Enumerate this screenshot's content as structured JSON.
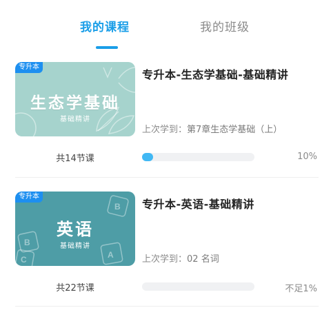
{
  "tabs": [
    {
      "label": "我的课程",
      "active": true
    },
    {
      "label": "我的班级",
      "active": false
    }
  ],
  "colors": {
    "accent": "#1a9ee8",
    "progress": "#41b8f4",
    "badge": "#1d8ff0",
    "cover1": "#a6d3cd",
    "cover2": "#4e9da6"
  },
  "courses": [
    {
      "badge": "专升本",
      "cover_title": "生态学基础",
      "cover_subtitle": "基础精讲",
      "title": "专升本-生态学基础-基础精讲",
      "last_study_label": "上次学到：",
      "last_study_value": "第7章生态学基础（上）",
      "lesson_count": "共14节课",
      "progress_fraction": 0.1,
      "progress_text": "10%"
    },
    {
      "badge": "专升本",
      "cover_title": "英语",
      "cover_subtitle": "基础精讲",
      "title": "专升本-英语-基础精讲",
      "last_study_label": "上次学到：",
      "last_study_value": "02 名词",
      "lesson_count": "共22节课",
      "progress_fraction": 0.0,
      "progress_text": "不足1%"
    }
  ]
}
